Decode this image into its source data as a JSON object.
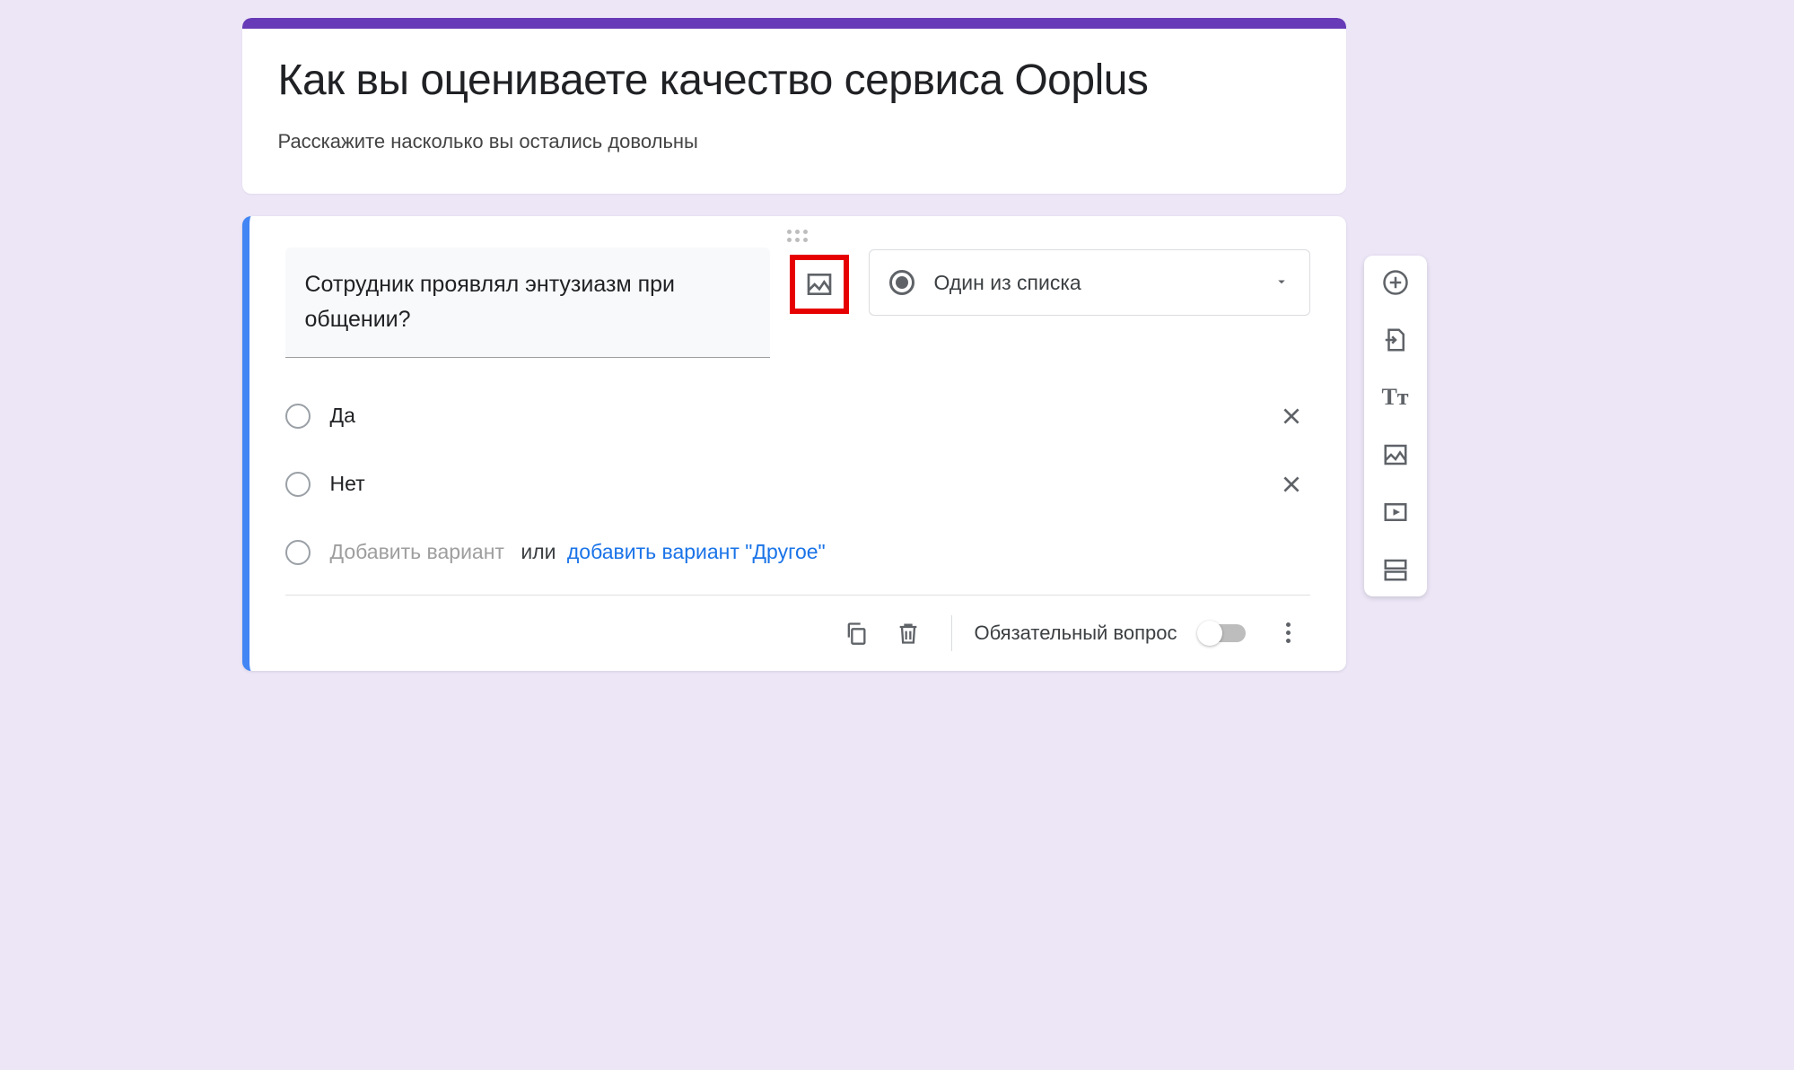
{
  "form": {
    "title": "Как вы оцениваете качество сервиса Ooplus",
    "description": "Расскажите насколько вы остались довольны"
  },
  "question": {
    "text": "Сотрудник проявлял энтузиазм при общении?",
    "type_label": "Один из списка",
    "options": [
      "Да",
      "Нет"
    ],
    "add_option_placeholder": "Добавить вариант",
    "or_label": "или",
    "add_other_label": "добавить вариант \"Другое\"",
    "required_label": "Обязательный вопрос",
    "required": false
  }
}
